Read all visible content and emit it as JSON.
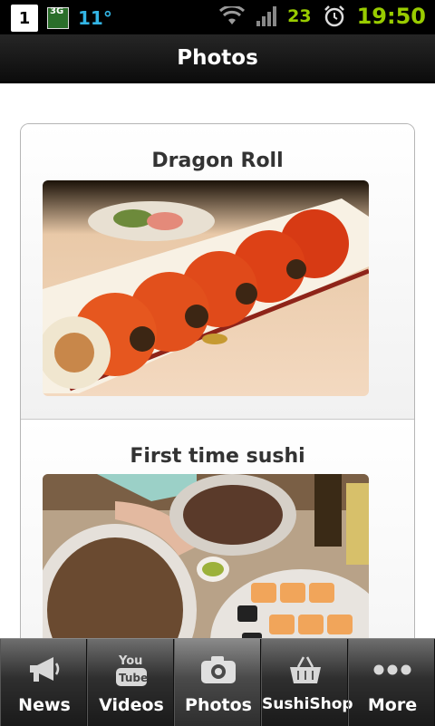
{
  "status_bar": {
    "notification_number": "1",
    "network_type": "3G",
    "temperature": "11°",
    "battery_level": "23",
    "time": "19:50"
  },
  "header": {
    "title": "Photos"
  },
  "photos": [
    {
      "title": "Dragon Roll",
      "image": "dragon-roll-photo"
    },
    {
      "title": "First time sushi",
      "image": "sushi-platters-photo"
    }
  ],
  "tabs": [
    {
      "label": "News",
      "icon": "megaphone-icon",
      "active": false
    },
    {
      "label": "Videos",
      "icon": "youtube-icon",
      "active": false
    },
    {
      "label": "Photos",
      "icon": "camera-icon",
      "active": true
    },
    {
      "label": "SushiShop",
      "icon": "basket-icon",
      "active": false
    },
    {
      "label": "More",
      "icon": "more-dots-icon",
      "active": false
    }
  ],
  "colors": {
    "accent_green": "#99cc00",
    "accent_blue": "#33b5e5"
  }
}
